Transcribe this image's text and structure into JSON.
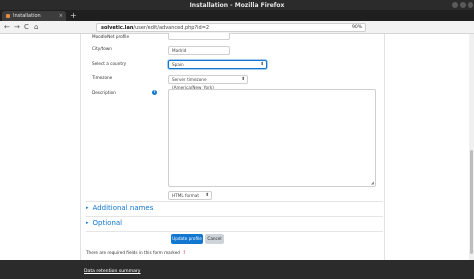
{
  "browser": {
    "window_title": "Installation - Mozilla Firefox",
    "tab_label": "Installation",
    "tab_close": "×",
    "new_tab": "+",
    "url_domain": "solvetic.lan",
    "url_path": "/user/edit/advanced.php?id=2",
    "zoom": "90%",
    "back": "←",
    "forward": "→",
    "reload": "C",
    "home": "⌂"
  },
  "form": {
    "moodlenet_label": "MoodleNet profile",
    "city_label": "City/town",
    "city_value": "Madrid",
    "country_label": "Select a country",
    "country_value": "Spain",
    "timezone_label": "Timezone",
    "timezone_value": "Server timezone (America/New_York)",
    "description_label": "Description",
    "help_icon": "?",
    "format_value": "HTML format",
    "resize_glyph": "◢",
    "caret": "⬍"
  },
  "sections": {
    "additional_names": "Additional names",
    "optional": "Optional",
    "chevron": "▸"
  },
  "buttons": {
    "update_profile": "Update profile",
    "cancel": "Cancel"
  },
  "notes": {
    "required_text": "There are required fields in this form marked",
    "required_marker": "!"
  },
  "footer": {
    "data_retention": "Data retention summary"
  },
  "colors": {
    "accent": "#1177d1",
    "footer_bg": "#2b2b2b",
    "titlebar_bg": "#2b2b2b"
  }
}
